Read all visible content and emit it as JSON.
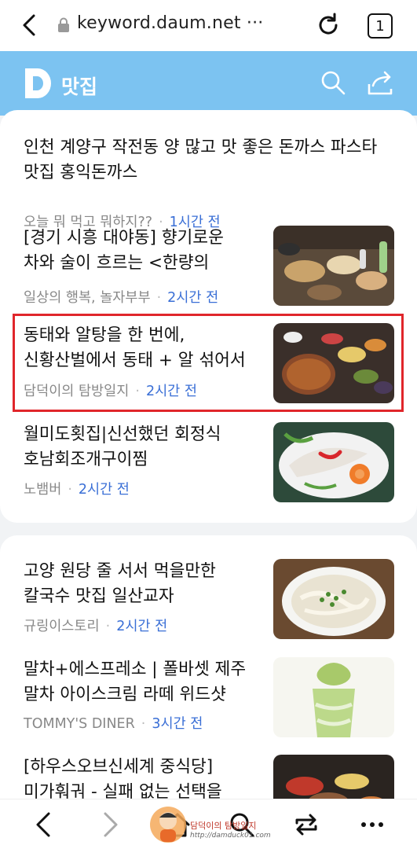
{
  "browser": {
    "url": "keyword.daum.net ···",
    "tab_count": "1"
  },
  "header": {
    "logo_letter": "D",
    "title": "맛집",
    "accent_color": "#7cc3f1"
  },
  "feed": {
    "card1": [
      {
        "title": "인천 계양구 작전동 양 많고 맛 좋은 돈까스 파스타 맛집 홍익돈까스",
        "source": "오늘 뭐 먹고 뭐하지??",
        "time": "1시간 전"
      },
      {
        "title": "[경기 시흥 대야동] 향기로운 차와 술이 흐르는 <한량의 커피...",
        "source": "일상의 행복, 놀자부부",
        "time": "2시간 전"
      },
      {
        "title": "동태와 알탕을 한 번에, 신황산벌에서 동태 + 알 섞어서 한 사발...",
        "source": "담덕이의 탐방일지",
        "time": "2시간 전"
      },
      {
        "title": "월미도횟집|신선했던 회정식 호남회조개구이찜",
        "source": "노뱀버",
        "time": "2시간 전"
      }
    ],
    "card2": [
      {
        "title": "고양 원당 줄 서서 먹을만한 칼국수 맛집 일산교자",
        "source": "규링이스토리",
        "time": "2시간 전"
      },
      {
        "title": "말차+에스프레소 | 폴바셋 제주 말차 아이스크림 라떼 위드샷",
        "source": "TOMMY'S DINER",
        "time": "3시간 전"
      },
      {
        "title": "[하우스오브신세계 중식당] 미가훠궈 - 실패 없는 선택을 하시...",
        "source": "",
        "time": ""
      }
    ]
  },
  "watermark": {
    "text": "담덕이의 탐방일지",
    "url": "http://damduck01.com"
  },
  "colors": {
    "time_link": "#3a6fd6",
    "highlight_border": "#e0262b"
  }
}
